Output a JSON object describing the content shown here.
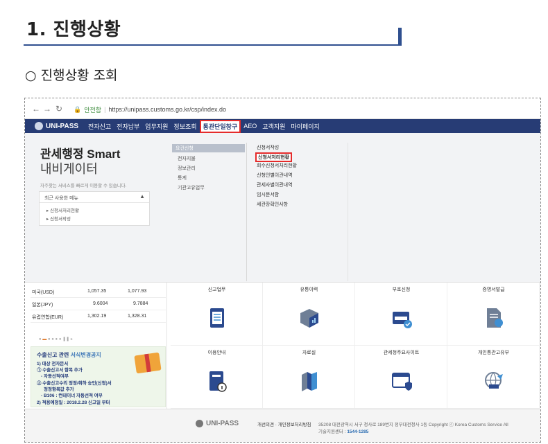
{
  "document": {
    "title": "1. 진행상황",
    "subheading": "○ 진행상황 조회"
  },
  "browser": {
    "secure_label": "안전함",
    "url": "https://unipass.customs.go.kr/csp/index.do"
  },
  "mainnav": {
    "logo": "UNI-PASS",
    "items": [
      "전자신고",
      "전자납부",
      "업무지원",
      "정보조회",
      "통관단일창구",
      "AEO",
      "고객지원",
      "마이페이지"
    ],
    "active_index": 4
  },
  "smartnav": {
    "title_line1": "관세행정 Smart",
    "title_line2": "내비게이터",
    "description": "자주찾는 서비스를 빠르게 이용할 수 있습니다.",
    "recent": {
      "label": "최근 사용한 메뉴",
      "items": [
        "▸ 신청서처리현황",
        "▸ 신청서작성"
      ]
    },
    "categories": [
      "요건신청",
      "전자지불",
      "정보관리",
      "통계",
      "기관고유업무"
    ],
    "selected_category": 0,
    "submenu": [
      "신청서작성",
      "신청서처리현황",
      "회수신청서처리현황",
      "신청인별이관내역",
      "관세사별이관내역",
      "임시문서함",
      "세관장확인사항"
    ],
    "highlighted_submenu": 1
  },
  "exchange_rates": [
    {
      "currency": "미국(USD)",
      "buy": "1,057.35",
      "sell": "1,077.93"
    },
    {
      "currency": "일본(JPY)",
      "buy": "9.6004",
      "sell": "9.7884"
    },
    {
      "currency": "유럽연합(EUR)",
      "buy": "1,302.19",
      "sell": "1,328.31"
    }
  ],
  "notice": {
    "title_prefix": "수출신고 관련 ",
    "title_highlight": "서식변경공지",
    "lines": [
      "1) 대상 전자문서",
      "① 수출신고서 항목 추가",
      "- 자동선적여부",
      "② 수출신고수리 정정/취하 승인(신청)서",
      "정정항목값 추가",
      "- B106 : 컨테이너 자동선적 여부",
      "2) 적용예정일 : 2018.2.28 신고일 부터"
    ]
  },
  "services": [
    {
      "label": "신고업무",
      "icon": "document-checklist-icon"
    },
    {
      "label": "유통이력",
      "icon": "box-chart-icon"
    },
    {
      "label": "부호신청",
      "icon": "form-check-icon"
    },
    {
      "label": "증명서발급",
      "icon": "certificate-icon"
    },
    {
      "label": "이용안내",
      "icon": "info-book-icon"
    },
    {
      "label": "자료실",
      "icon": "books-icon"
    },
    {
      "label": "관세청주요사이트",
      "icon": "browser-shield-icon"
    },
    {
      "label": "개인통관고유부",
      "icon": "globe-plane-icon"
    }
  ],
  "footer": {
    "logo": "UNI-PASS",
    "links": "개선의견 · 개인정보처리방침",
    "address": "35208 대전광역시 서구 청사로 189번지 정부대전청사 1동  Copyright ⓒ Korea Customs Service All",
    "center_label": "기술지원센터 : ",
    "center_phone": "1544-1285"
  },
  "colors": {
    "nav_bg": "#273c75",
    "highlight_border": "#e52b2b",
    "heading_rule": "#2f4f8f"
  }
}
